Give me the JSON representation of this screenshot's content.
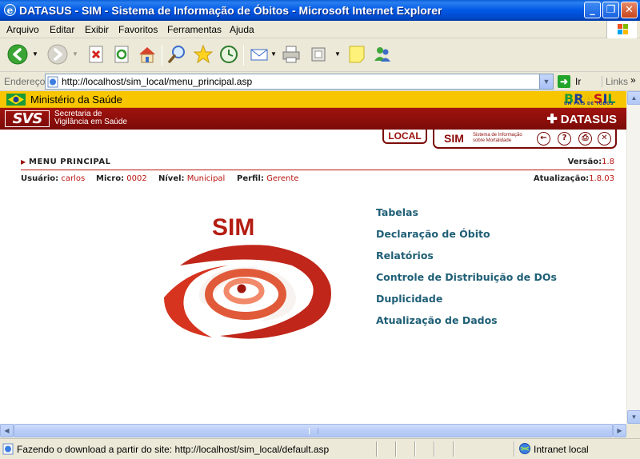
{
  "window": {
    "title": "DATASUS - SIM - Sistema de Informação de Óbitos - Microsoft Internet Explorer",
    "minimize_label": "_",
    "maximize_label": "❐",
    "close_label": "✕"
  },
  "menubar": [
    "Arquivo",
    "Editar",
    "Exibir",
    "Favoritos",
    "Ferramentas",
    "Ajuda"
  ],
  "address": {
    "label": "Endereço",
    "url": "http://localhost/sim_local/menu_principal.asp",
    "go_label": "Ir",
    "links_label": "Links"
  },
  "header": {
    "ministerio": "Ministério da Saúde",
    "brasil_tagline": "UM PAÍS DE TODOS",
    "svs_logo": "SVS",
    "svs_line1": "Secretaria de",
    "svs_line2": "Vigilância em Saúde",
    "datasus": "DATASUS",
    "local_tab": "LOCAL",
    "sim_label": "SIM",
    "sim_sub": "Sistema de Informação sobre Mortalidade"
  },
  "page": {
    "menu_title": "MENU PRINCIPAL",
    "versao_label": "Versão:",
    "versao_value": "1.8",
    "usuario_label": "Usuário:",
    "usuario_value": "carlos",
    "micro_label": "Micro:",
    "micro_value": "0002",
    "nivel_label": "Nível:",
    "nivel_value": "Municipal",
    "perfil_label": "Perfil:",
    "perfil_value": "Gerente",
    "atualizacao_label": "Atualização:",
    "atualizacao_value": "1.8.03",
    "logo_text": "SIM"
  },
  "menu_links": [
    "Tabelas",
    "Declaração de Óbito",
    "Relatórios",
    "Controle de Distribuição de DOs",
    "Duplicidade",
    "Atualização de Dados"
  ],
  "status": {
    "text": "Fazendo o download a partir do site: http://localhost/sim_local/default.asp",
    "zone": "Intranet local"
  }
}
